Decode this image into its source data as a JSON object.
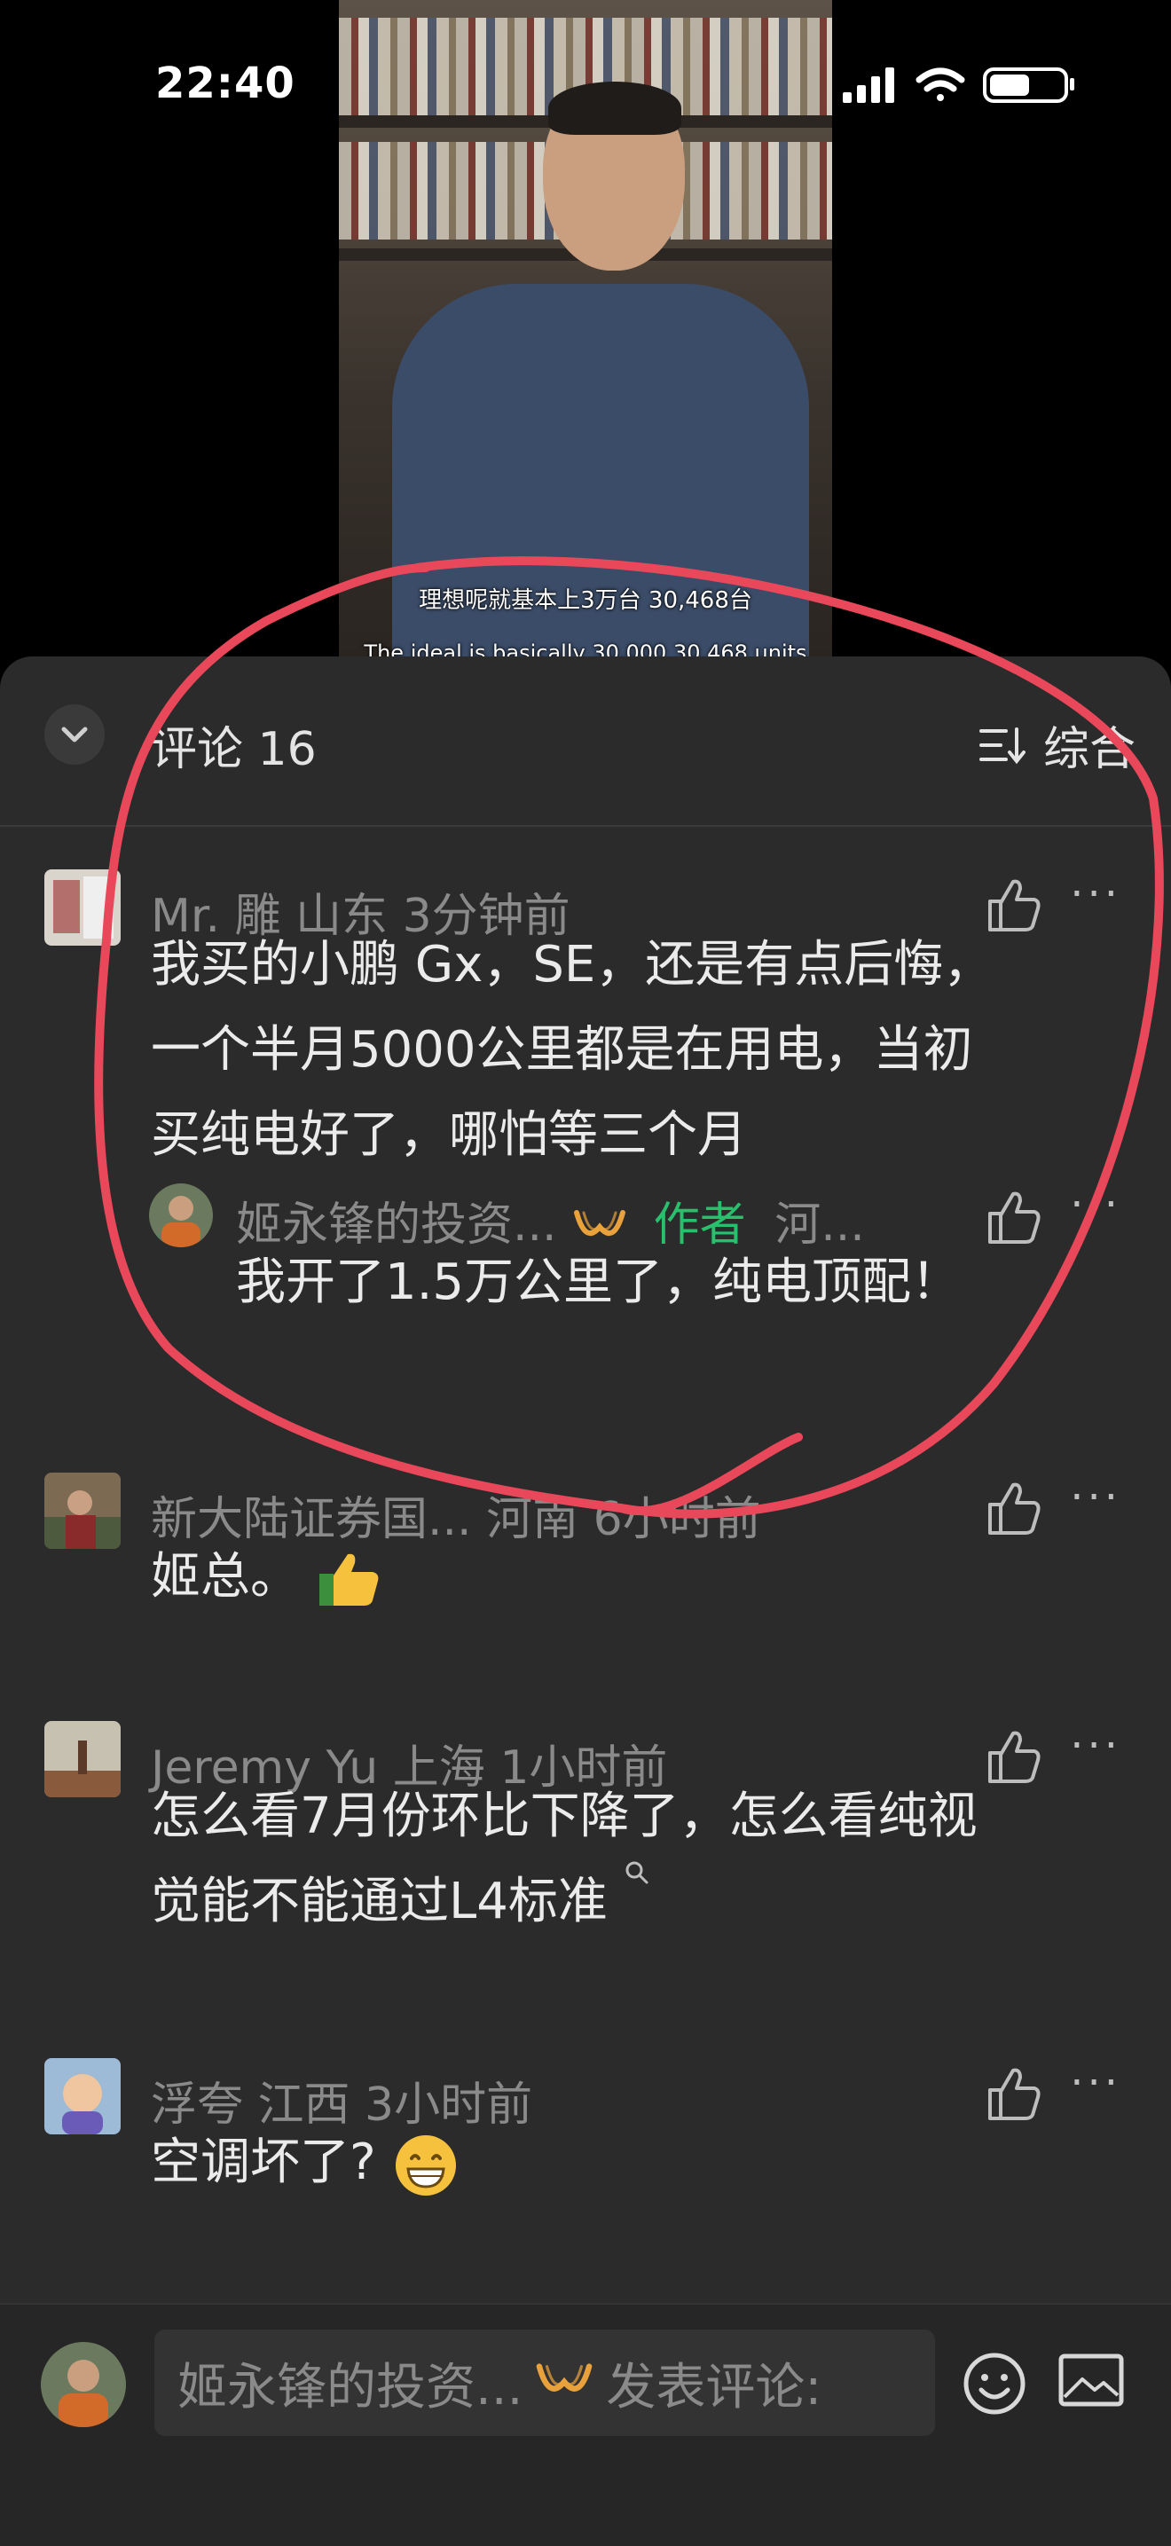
{
  "status_bar": {
    "time": "22:40"
  },
  "video": {
    "subtitle_cn": "理想呢就基本上3万台 30,468台",
    "subtitle_en": "The ideal is basically 30,000 30,468 units"
  },
  "comments_panel": {
    "title": "评论 16",
    "sort_label": "综合"
  },
  "comments": [
    {
      "meta": "Mr. 雕  山东  3分钟前",
      "lines": [
        "我买的小鹏 Gx，SE，还是有点后悔，",
        "一个半月5000公里都是在用电，当初",
        "买纯电好了，哪怕等三个月"
      ],
      "reply": {
        "name": "姬永锋的投资...",
        "author_tag": "作者",
        "location": "河...",
        "text": "我开了1.5万公里了，纯电顶配！"
      }
    },
    {
      "meta": "新大陆证券国...  河南  6小时前",
      "text": "姬总。"
    },
    {
      "meta": "Jeremy Yu  上海  1小时前",
      "lines": [
        "怎么看7月份环比下降了，怎么看纯视",
        "觉能不能通过L4标准"
      ]
    },
    {
      "meta": "浮夸  江西  3小时前",
      "text": "空调坏了?"
    }
  ],
  "footer": {
    "input_name": "姬永锋的投资...",
    "input_placeholder": "发表评论:"
  },
  "colors": {
    "sheet_bg": "#2b2b2b",
    "author_green": "#29c06d",
    "annotation_red": "#e8485a"
  }
}
